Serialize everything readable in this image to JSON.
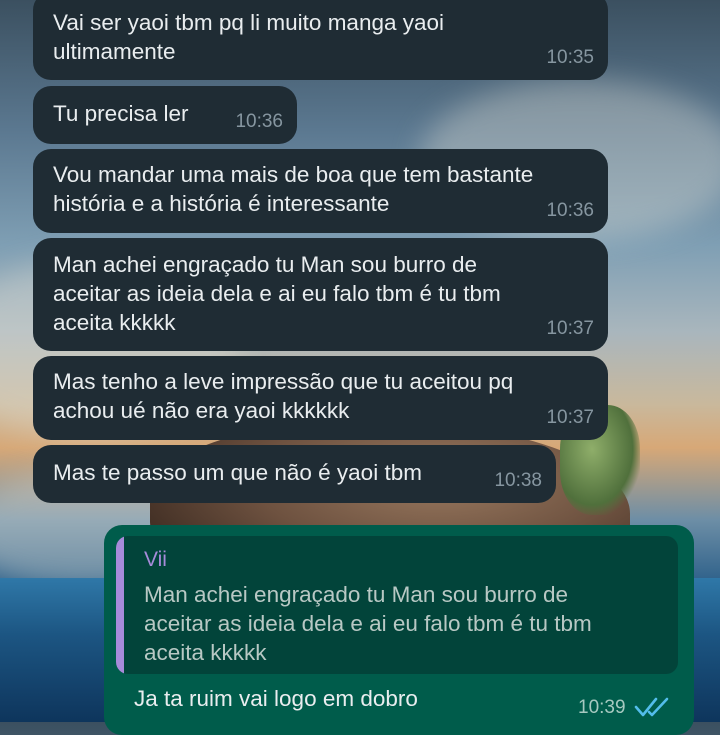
{
  "messages": [
    {
      "text": "Vai ser yaoi tbm pq li muito manga yaoi\nultimamente",
      "time": "10:35"
    },
    {
      "text": "Tu precisa ler",
      "time": "10:36"
    },
    {
      "text": "Vou mandar uma mais de boa que tem bastante\nhistória e a história é interessante",
      "time": "10:36"
    },
    {
      "text": "Man achei engraçado tu Man sou burro de\naceitar as ideia dela e ai eu falo tbm é tu tbm\naceita kkkkk",
      "time": "10:37"
    },
    {
      "text": "Mas tenho a leve impressão que tu aceitou pq\nachou ué não era yaoi kkkkkk",
      "time": "10:37"
    },
    {
      "text": "Mas te passo um que não é yaoi tbm",
      "time": "10:38"
    }
  ],
  "reply": {
    "quote_author": "Vii",
    "quote_text": "Man achei engraçado tu Man sou burro de\naceitar as ideia dela e ai eu falo tbm é tu tbm\naceita kkkkk",
    "text": "Ja ta ruim vai logo em dobro",
    "time": "10:39",
    "status_icon": "double-check-read-icon"
  },
  "colors": {
    "incoming_bubble": "#1f2c34",
    "outgoing_bubble": "#005c4b",
    "quote_accent": "#a78bda",
    "read_ticks": "#53bdeb"
  }
}
